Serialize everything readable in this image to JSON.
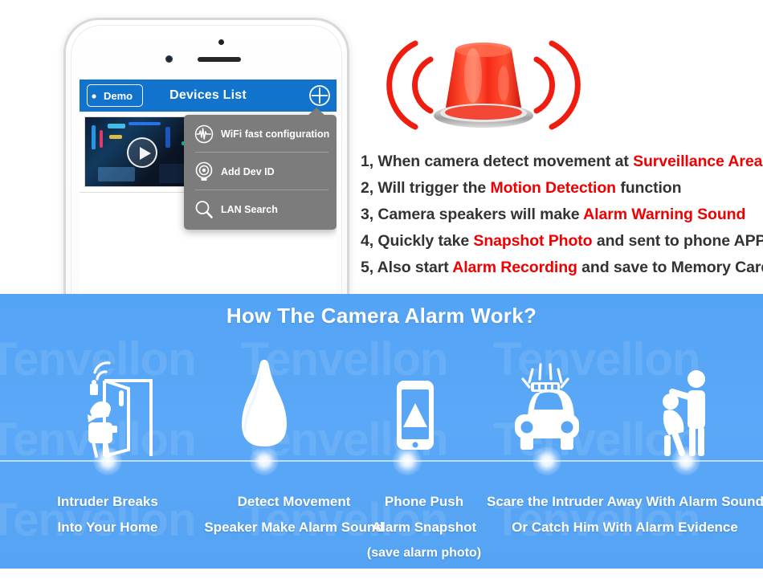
{
  "watermark": {
    "text": "Tenvellon"
  },
  "phone": {
    "app": {
      "nav": {
        "back_label": "Demo",
        "title": "Devices List",
        "add_icon": "plus-circle-icon",
        "back_icon": "chevron-left-icon"
      },
      "device_thumbnail": {
        "play_icon": "play-icon"
      },
      "dropdown_menu": {
        "items": [
          {
            "label": "WiFi fast configuration",
            "icon": "wifi-waveform-icon"
          },
          {
            "label": "Add Dev ID",
            "icon": "camera-dome-icon"
          },
          {
            "label": "LAN Search",
            "icon": "magnifier-icon"
          }
        ]
      }
    }
  },
  "siren": {
    "icon": "red-alarm-beacon-icon"
  },
  "features": [
    {
      "num": "1, ",
      "pre": "When camera detect movement at ",
      "highlight": "Surveillance Area",
      "post": ""
    },
    {
      "num": "2, ",
      "pre": "Will trigger the ",
      "highlight": "Motion Detection",
      "post": " function"
    },
    {
      "num": "3, ",
      "pre": "Camera speakers will make ",
      "highlight": "Alarm Warning Sound",
      "post": ""
    },
    {
      "num": "4, ",
      "pre": "Quickly take ",
      "highlight": "Snapshot Photo",
      "post": " and sent to phone APP"
    },
    {
      "num": "5, ",
      "pre": "Also start ",
      "highlight": "Alarm Recording",
      "post": " and save to Memory Card"
    }
  ],
  "banner": {
    "title": "How The Camera Alarm Work?",
    "steps": [
      {
        "icon": "intruder-at-door-icon",
        "caption_lines": [
          "Intruder Breaks",
          "Into Your Home"
        ]
      },
      {
        "icon": "alarm-speaker-bulb-icon",
        "caption_lines": [
          "Detect Movement",
          "Speaker Make Alarm Sound"
        ]
      },
      {
        "icon": "phone-push-alert-icon",
        "caption_lines": [
          "Phone Push",
          "Alarm Snapshot",
          "(save alarm photo)"
        ]
      },
      {
        "icon": "police-car-icon",
        "caption_lines": [
          "Scare the Intruder Away With Alarm Sound",
          "Or Catch Him With Alarm Evidence"
        ]
      },
      {
        "icon": "police-catching-intruder-icon",
        "caption_lines": []
      }
    ]
  },
  "colors": {
    "banner_blue": "#5AA8F5",
    "navbar_blue": "#1273CD",
    "highlight_red": "#F00000",
    "menu_gray": "#7C7C7C",
    "siren_red": "#F5281B"
  }
}
